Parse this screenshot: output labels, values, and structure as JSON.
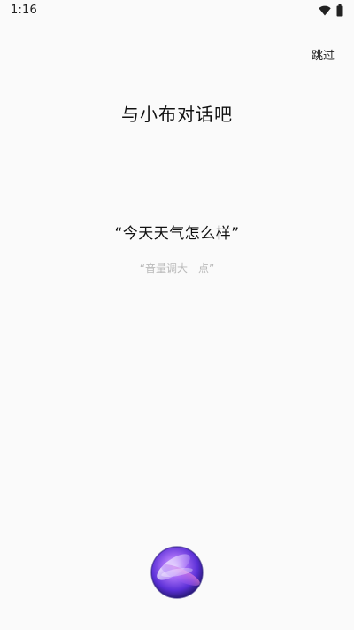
{
  "status_bar": {
    "time": "1:16",
    "icons": [
      "wifi-icon",
      "battery-icon"
    ]
  },
  "header": {
    "skip_label": "跳过"
  },
  "main": {
    "title": "与小布对话吧",
    "suggestion_primary": "“今天天气怎么样”",
    "suggestion_secondary": "“音量调大一点”"
  },
  "assistant": {
    "icon": "voice-assistant-orb-icon"
  },
  "colors": {
    "background": "#fafafa",
    "text_primary": "#111111",
    "text_hint": "#b9b9b9",
    "orb_accent": "#7b3fe4"
  }
}
